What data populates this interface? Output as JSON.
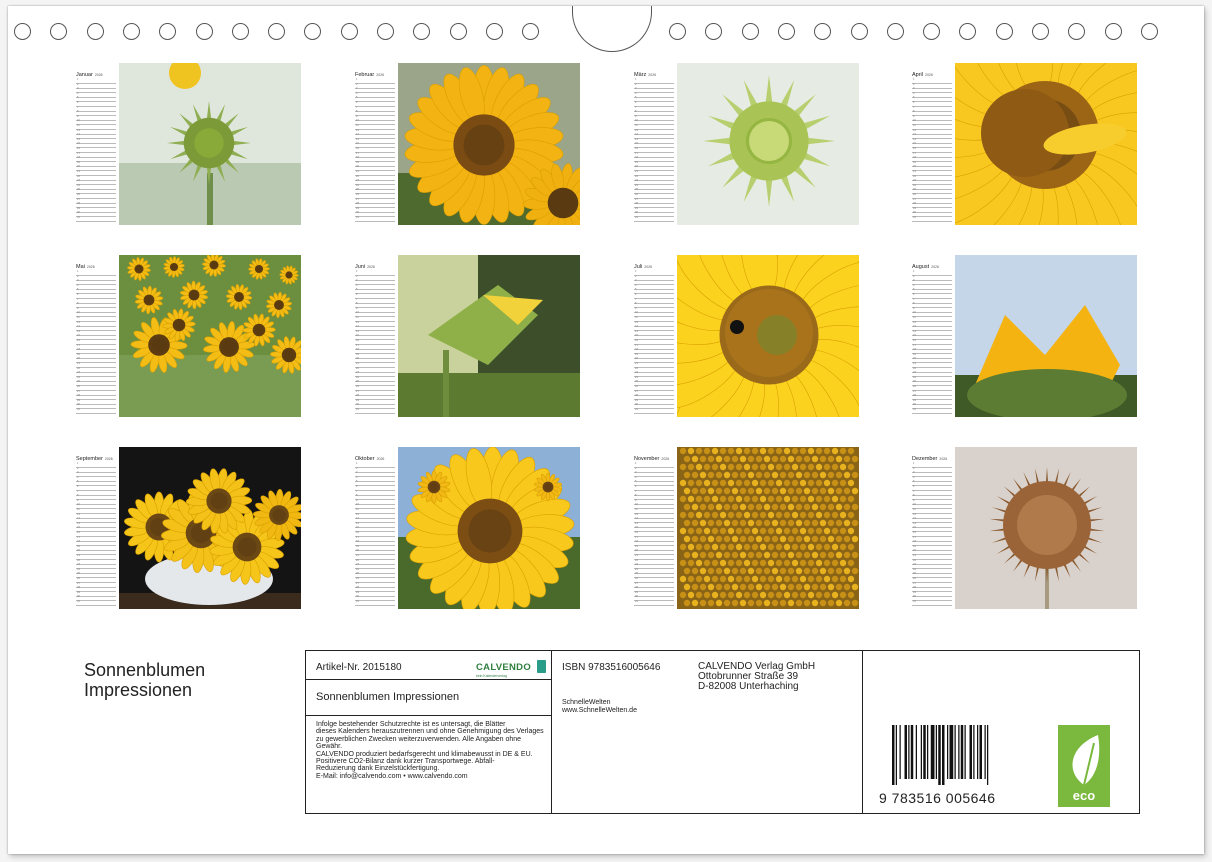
{
  "year": "2026",
  "months": [
    {
      "name": "Januar",
      "photo": "sunflower-bud-green-icon"
    },
    {
      "name": "Februar",
      "photo": "sunflower-bloom-icon"
    },
    {
      "name": "März",
      "photo": "sunflower-bud-closeup-icon"
    },
    {
      "name": "April",
      "photo": "sunflower-petals-closeup-icon"
    },
    {
      "name": "Mai",
      "photo": "sunflower-field-icon"
    },
    {
      "name": "Juni",
      "photo": "sunflower-opening-side-icon"
    },
    {
      "name": "Juli",
      "photo": "sunflower-with-bee-icon"
    },
    {
      "name": "August",
      "photo": "sunflower-opening-icon"
    },
    {
      "name": "September",
      "photo": "sunflower-bouquet-icon"
    },
    {
      "name": "Oktober",
      "photo": "sunflower-bloom-sky-icon"
    },
    {
      "name": "November",
      "photo": "sunflower-seeds-closeup-icon"
    },
    {
      "name": "Dezember",
      "photo": "dried-sunflower-icon"
    }
  ],
  "cover": {
    "title_line1": "Sonnenblumen",
    "title_line2": "Impressionen"
  },
  "info": {
    "article_no": "Artikel-Nr. 2015180",
    "brand": "CALVENDO",
    "brand_tagline": "kein Kalenderverlag",
    "title": "Sonnenblumen Impressionen",
    "legal_lines": [
      "Infolge bestehender Schutzrechte ist es untersagt, die Blätter",
      "dieses Kalenders herauszutrennen und ohne Genehmigung des Verlages",
      "zu gewerblichen Zwecken weiterzuverwenden. Alle Angaben ohne",
      "Gewähr.",
      "CALVENDO produziert bedarfsgerecht und klimabewusst in DE & EU.",
      "Positivere CO2-Bilanz dank kurzer Transportwege. Abfall-",
      "Reduzierung dank Einzelstückfertigung.",
      "E-Mail: info@calvendo.com • www.calvendo.com"
    ],
    "isbn": "ISBN 9783516005646",
    "publisher_name": "CALVENDO Verlag GmbH",
    "publisher_street": "Ottobrunner Straße 39",
    "publisher_city": "D-82008 Unterhaching",
    "author": "SchnelleWelten",
    "author_url": "www.SchnelleWelten.de",
    "barcode_digits": "9 783516 005646",
    "eco_label": "eco"
  }
}
